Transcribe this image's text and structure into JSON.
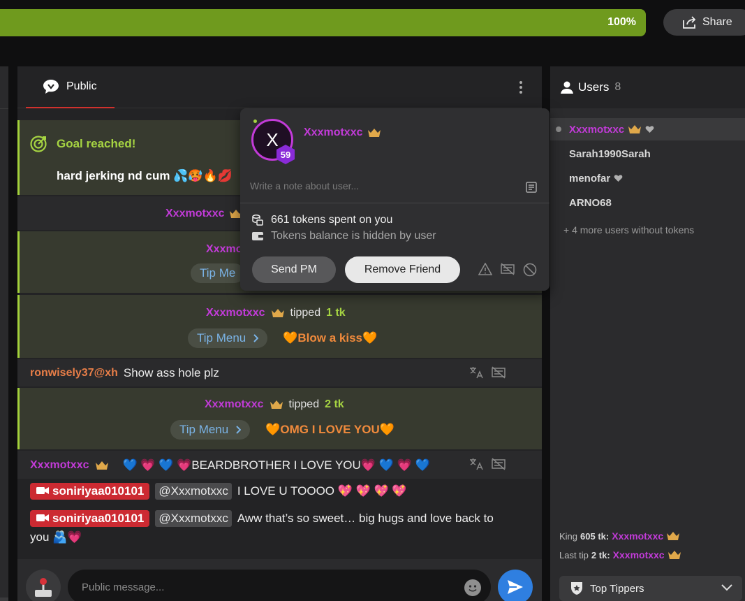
{
  "topbar": {
    "progress_label": "100%",
    "progress_value": 100,
    "share_label": "Share"
  },
  "chat": {
    "tab_public": "Public",
    "goal": {
      "title": "Goal reached!",
      "text": "hard jerking nd cum 💦🥵🔥💋"
    },
    "rows": [
      {
        "user": "Xxxmotxxc"
      },
      {
        "user": "Xxxmo",
        "tip_menu": "Tip Me"
      },
      {
        "user": "Xxxmotxxc",
        "tipped": "tipped",
        "tk": "1 tk",
        "tip_menu": "Tip Menu",
        "reward": "🧡Blow a kiss🧡"
      },
      {
        "user": "ronwisely37@xh",
        "text": "Show ass hole plz"
      },
      {
        "user": "Xxxmotxxc",
        "tipped": "tipped",
        "tk": "2 tk",
        "tip_menu": "Tip Menu",
        "reward": "🧡OMG I LOVE YOU🧡"
      },
      {
        "user": "Xxxmotxxc",
        "text": "💙 💗 💙 💗BEARDBROTHER I LOVE YOU💗 💙 💗 💙"
      },
      {
        "user": "soniriyaa010101",
        "mention": "@Xxxmotxxc",
        "text": "I LOVE U TOOOO 💖 💖 💖 💖"
      },
      {
        "user": "soniriyaa010101",
        "mention": "@Xxxmotxxc",
        "text": "Aww that’s so sweet… big hugs and love back to",
        "text2": "you 🫂💗"
      }
    ],
    "input_placeholder": "Public message..."
  },
  "users": {
    "title": "Users",
    "count": "8",
    "list": [
      {
        "name": "Xxxmotxxc"
      },
      {
        "name": "Sarah1990Sarah"
      },
      {
        "name": "menofar"
      },
      {
        "name": "ARNO68"
      }
    ],
    "more": "+ 4 more users without tokens",
    "king_label": "King",
    "king_tk": "605 tk:",
    "king_user": "Xxxmotxxc",
    "last_label": "Last tip",
    "last_tk": "2 tk:",
    "last_user": "Xxxmotxxc",
    "top_tippers": "Top Tippers"
  },
  "popup": {
    "avatar_letter": "X",
    "level": "59",
    "name": "Xxxmotxxc",
    "note_placeholder": "Write a note about user...",
    "tokens_spent": "661 tokens spent on you",
    "balance": "Tokens balance is hidden by user",
    "send_pm": "Send PM",
    "remove_friend": "Remove Friend"
  },
  "colors": {
    "accent_green": "#a6d442",
    "username_purple": "#c23bd8",
    "tip_blue": "#7ab3e6",
    "reward_orange": "#f08a3c",
    "live_red": "#cc2a32",
    "send_blue": "#2f7fe0"
  }
}
